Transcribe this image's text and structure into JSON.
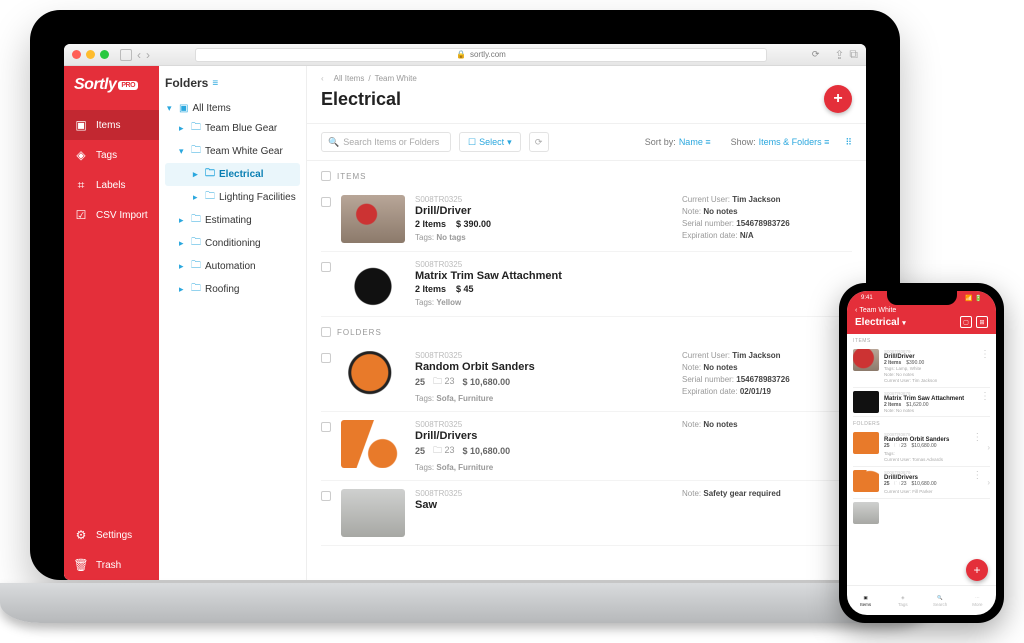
{
  "browser": {
    "url": "sortly.com"
  },
  "brand": {
    "name": "Sortly",
    "badge": "PRO"
  },
  "nav": {
    "items": "Items",
    "tags": "Tags",
    "labels": "Labels",
    "csv": "CSV Import",
    "settings": "Settings",
    "trash": "Trash"
  },
  "folders": {
    "title": "Folders",
    "rows": {
      "all": "All Items",
      "blue": "Team Blue Gear",
      "white": "Team White Gear",
      "electrical": "Electrical",
      "lighting": "Lighting Facilities",
      "estimating": "Estimating",
      "conditioning": "Conditioning",
      "automation": "Automation",
      "roofing": "Roofing"
    }
  },
  "main": {
    "crumbs": {
      "c1": "All Items",
      "c2": "Team White"
    },
    "title": "Electrical",
    "search_placeholder": "Search Items or Folders",
    "select": "Select",
    "sort_label": "Sort by:",
    "sort_value": "Name",
    "show_label": "Show:",
    "show_value": "Items & Folders"
  },
  "sections": {
    "items": "ITEMS",
    "folders": "FOLDERS"
  },
  "items": {
    "i1": {
      "sku": "S008TR0325",
      "name": "Drill/Driver",
      "qty": "2 Items",
      "price": "$ 390.00",
      "tags_label": "Tags:",
      "tags": "No tags",
      "user_label": "Current User:",
      "user": "Tim Jackson",
      "note_label": "Note:",
      "note": "No notes",
      "sn_label": "Serial number:",
      "sn": "154678983726",
      "exp_label": "Expiration date:",
      "exp": "N/A"
    },
    "i2": {
      "sku": "S008TR0325",
      "name": "Matrix Trim Saw Attachment",
      "qty": "2 Items",
      "price": "$ 45",
      "tags_label": "Tags:",
      "tags": "Yellow"
    }
  },
  "folders_list": {
    "f1": {
      "sku": "S008TR0325",
      "name": "Random Orbit Sanders",
      "qty": "25",
      "sub": "23",
      "price": "$ 10,680.00",
      "tags_label": "Tags:",
      "tags": "Sofa, Furniture",
      "user_label": "Current User:",
      "user": "Tim Jackson",
      "note_label": "Note:",
      "note": "No notes",
      "sn_label": "Serial number:",
      "sn": "154678983726",
      "exp_label": "Expiration date:",
      "exp": "02/01/19"
    },
    "f2": {
      "sku": "S008TR0325",
      "name": "Drill/Drivers",
      "qty": "25",
      "sub": "23",
      "price": "$ 10,680.00",
      "tags_label": "Tags:",
      "tags": "Sofa, Furniture",
      "note_label": "Note:",
      "note": "No notes"
    },
    "f3": {
      "sku": "S008TR0325",
      "name": "Saw",
      "note_label": "Note:",
      "note": "Safety gear required"
    }
  },
  "phone": {
    "time": "9:41",
    "back": "Team White",
    "title": "Electrical",
    "sect_items": "ITEMS",
    "sect_folders": "FOLDERS",
    "i1": {
      "sku": "S008TR0879",
      "name": "Drill/Driver",
      "qty": "2 Items",
      "price": "$390.00",
      "m1": "Tags: Lamp, White",
      "m2": "Note: No notes",
      "m3": "Current User: Tim Jackson"
    },
    "i2": {
      "sku": "S008TR0879",
      "name": "Matrix Trim Saw Attachment",
      "qty": "2 Items",
      "price": "$1,620.00",
      "m1": "Note: No notes"
    },
    "f1": {
      "sku": "S008TR0879",
      "name": "Random Orbit Sanders",
      "qty": "25",
      "sub": "23",
      "price": "$10,680.00",
      "m1": "Tags:",
      "m2": "Current User: Tomas Advards"
    },
    "f2": {
      "sku": "S008TR0879",
      "name": "Drill/Drivers",
      "qty": "25",
      "sub": "23",
      "price": "$10,680.00",
      "m1": "Current User: Fill Parker"
    },
    "tabs": {
      "items": "Items",
      "tags": "Tags",
      "search": "Search",
      "more": "More"
    }
  }
}
